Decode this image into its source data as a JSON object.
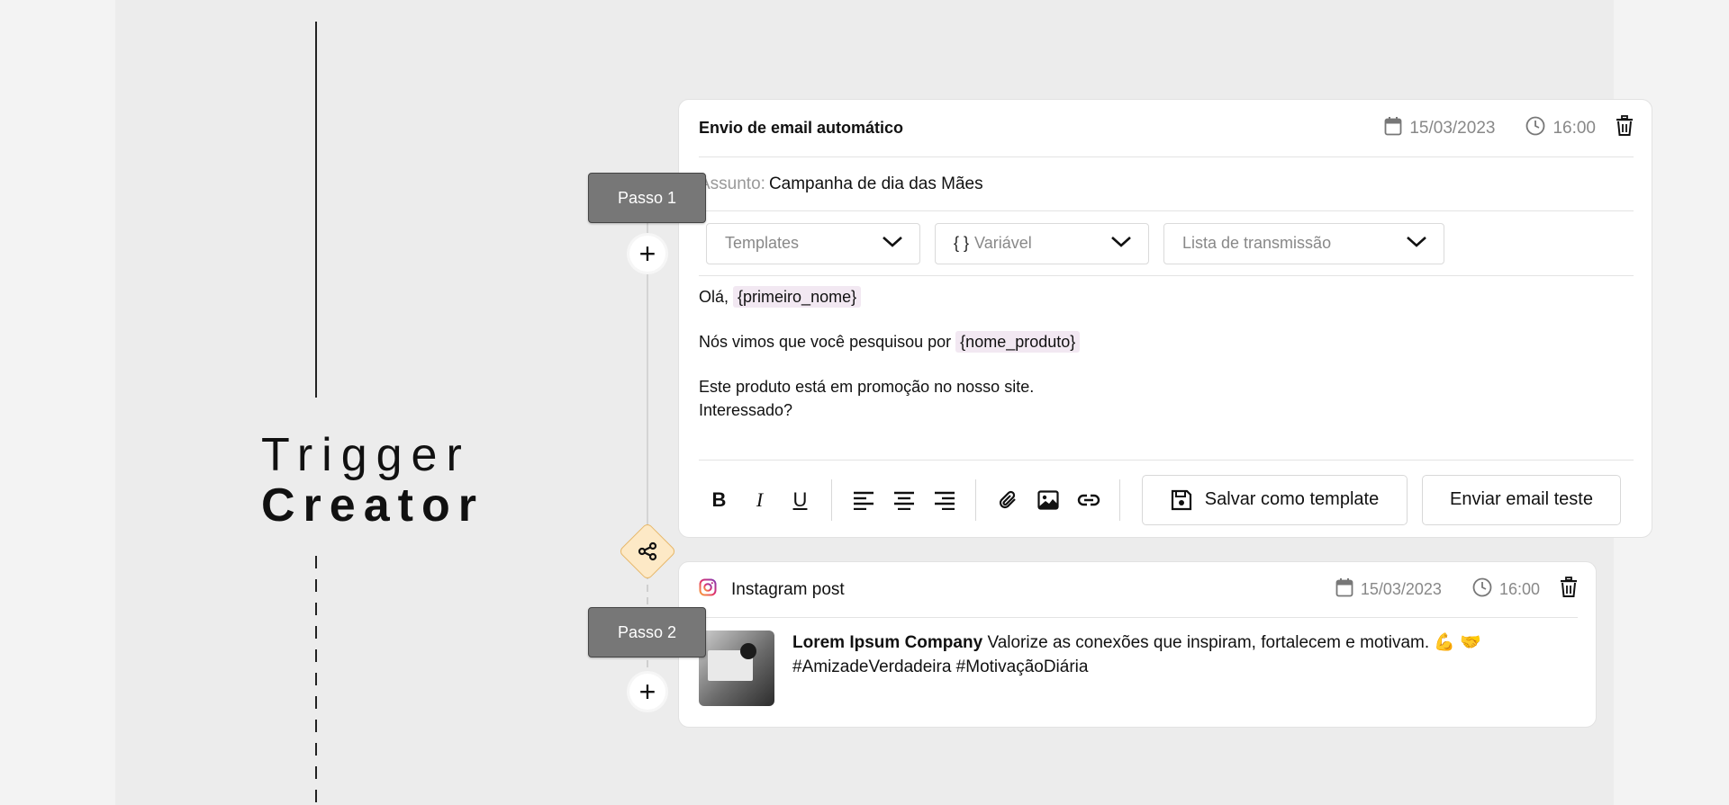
{
  "brand": {
    "line1": "Trigger",
    "line2": "Creator"
  },
  "steps": [
    {
      "label": "Passo 1"
    },
    {
      "label": "Passo 2"
    }
  ],
  "email_card": {
    "title": "Envio de email automático",
    "date": "15/03/2023",
    "time": "16:00",
    "subject_label": "Assunto:",
    "subject_value": "Campanha de dia das Mães",
    "selects": {
      "templates": "Templates",
      "variable_brace": "{ }",
      "variable": "Variável",
      "list": "Lista de transmissão"
    },
    "body": {
      "greeting": "Olá,",
      "var_first_name": "{primeiro_nome}",
      "line2_prefix": "Nós vimos que você pesquisou por",
      "var_product": "{nome_produto}",
      "line3": "Este produto está em promoção no nosso site.",
      "line4": "Interessado?"
    },
    "toolbar": {
      "bold": "B",
      "italic": "I",
      "underline": "U",
      "save_template": "Salvar como template",
      "send_test": "Enviar email teste"
    }
  },
  "instagram_card": {
    "title": "Instagram post",
    "date": "15/03/2023",
    "time": "16:00",
    "company": "Lorem Ipsum Company",
    "text": "Valorize as conexões que inspiram, fortalecem e motivam. 💪 🤝",
    "hashtags": "#AmizadeVerdadeira #MotivaçãoDiária"
  },
  "colors": {
    "accent_diamond": "#fde9c6",
    "tag_bg": "#f2e8f2",
    "badge_bg": "#777777"
  }
}
